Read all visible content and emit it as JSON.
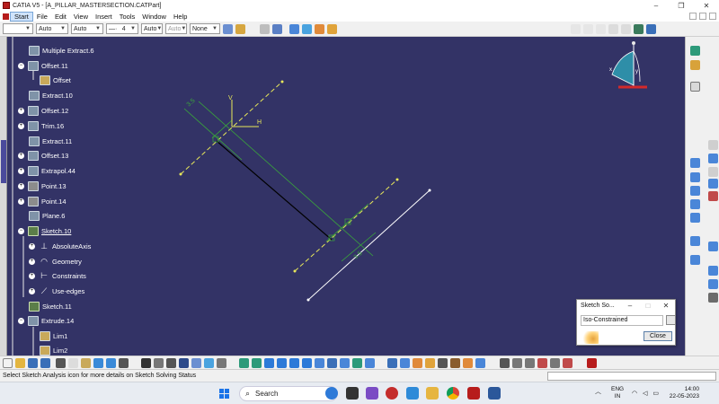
{
  "window": {
    "title": "CATIA V5 - [A_PILLAR_MASTERSECTION.CATPart]",
    "minimize_glyph": "–",
    "restore_glyph": "❐",
    "close_glyph": "✕"
  },
  "menu": {
    "items": [
      "Start",
      "File",
      "Edit",
      "View",
      "Insert",
      "Tools",
      "Window",
      "Help"
    ]
  },
  "toolbar": {
    "combo_1": "",
    "combo_2": "Auto",
    "combo_3": "Auto",
    "combo_4": "—·",
    "combo_4_value": "4",
    "combo_5": "Auto",
    "combo_6": "Auto",
    "combo_7": "None"
  },
  "tree": {
    "nodes": [
      {
        "label": "Multiple Extract.6",
        "icon": "extract-icon"
      },
      {
        "label": "Offset.11",
        "icon": "offset-icon"
      },
      {
        "label": "Offset",
        "icon": "parameter-icon"
      },
      {
        "label": "Extract.10",
        "icon": "extract-icon"
      },
      {
        "label": "Offset.12",
        "icon": "offset-icon"
      },
      {
        "label": "Trim.16",
        "icon": "trim-icon"
      },
      {
        "label": "Extract.11",
        "icon": "extract-icon"
      },
      {
        "label": "Offset.13",
        "icon": "offset-icon"
      },
      {
        "label": "Extrapol.44",
        "icon": "extrapol-icon"
      },
      {
        "label": "Point.13",
        "icon": "point-icon"
      },
      {
        "label": "Point.14",
        "icon": "point-icon"
      },
      {
        "label": "Plane.6",
        "icon": "plane-icon"
      },
      {
        "label": "Sketch.10",
        "icon": "sketch-icon"
      },
      {
        "label": "AbsoluteAxis",
        "icon": "axis-icon"
      },
      {
        "label": "Geometry",
        "icon": "geometry-icon"
      },
      {
        "label": "Constraints",
        "icon": "constraints-icon"
      },
      {
        "label": "Use-edges",
        "icon": "use-edges-icon"
      },
      {
        "label": "Sketch.11",
        "icon": "sketch-icon"
      },
      {
        "label": "Extrude.14",
        "icon": "extrude-icon"
      },
      {
        "label": "Lim1",
        "icon": "limit-icon"
      },
      {
        "label": "Lim2",
        "icon": "limit-icon"
      }
    ]
  },
  "sketch": {
    "axis_v_label": "V",
    "axis_h_label": "H",
    "dimension_1": "3.5",
    "dimension_2": "3.5"
  },
  "compass": {
    "x_label": "x",
    "y_label": "y",
    "z_label": "z"
  },
  "dialog": {
    "title": "Sketch So...",
    "status_value": "Iso-Constrained",
    "close_button": "Close",
    "minimize_glyph": "–",
    "maximize_glyph": "□",
    "close_glyph": "✕"
  },
  "status": {
    "message": "Select Sketch Analysis icon for more details on Sketch Solving Status"
  },
  "taskbar": {
    "search_label": "Search",
    "tray_arrow": "︿",
    "lang_1": "ENG",
    "lang_2": "IN",
    "time": "14:00",
    "date": "22-05-2023"
  },
  "colors": {
    "viewport_bg": "#333366",
    "sketch_green": "#3aa83a",
    "sketch_yellow": "#e8e85a",
    "sketch_white": "#ffffff",
    "sketch_black": "#000000"
  }
}
